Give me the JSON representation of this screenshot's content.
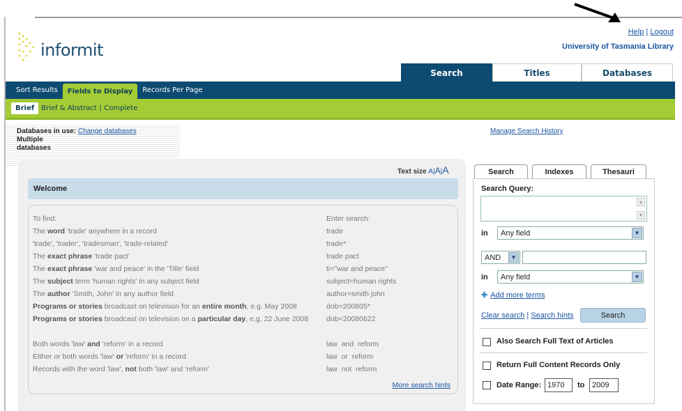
{
  "header": {
    "logo_text": "informit",
    "help": "Help",
    "sep": "|",
    "logout": "Logout",
    "library": "University of Tasmania Library"
  },
  "main_tabs": [
    {
      "label": "Search",
      "active": true
    },
    {
      "label": "Titles",
      "active": false
    },
    {
      "label": "Databases",
      "active": false
    }
  ],
  "nav": [
    {
      "label": "Sort Results",
      "active": false
    },
    {
      "label": "Fields to Display",
      "active": true
    },
    {
      "label": "Records Per Page",
      "active": false
    }
  ],
  "subnav": {
    "brief": "Brief",
    "brief_abstract": "Brief & Abstract",
    "sep": "|",
    "complete": "Complete"
  },
  "db_info": {
    "label": "Databases in use:",
    "change": "Change databases",
    "value_line1": "Multiple",
    "value_line2": "databases"
  },
  "manage_history": "Manage Search History",
  "text_size": {
    "label": "Text size",
    "a1": "A",
    "sep1": "|",
    "a2": "A",
    "sep2": "|",
    "a3": "A"
  },
  "welcome": "Welcome",
  "examples": {
    "head_find": "To find:",
    "head_enter": "Enter search:",
    "rows": [
      {
        "find": "The word 'trade' anywhere in a record",
        "enter": "trade"
      },
      {
        "find": "'trade', 'trader', 'tradesman', 'trade-related'",
        "enter": "trade*"
      },
      {
        "find": "The exact phrase 'trade pact'",
        "enter": "trade pact"
      },
      {
        "find": "The exact phrase 'war and peace' in the 'Title' field",
        "enter": "ti=\"war and peace\""
      },
      {
        "find": "The subject term 'human rights' in any subject field",
        "enter": "subject=human rights"
      },
      {
        "find": "The author 'Smith, John' in any author field",
        "enter": "author=smith john"
      },
      {
        "find": "Programs or stories broadcast on television for an entire month, e.g. May 2008",
        "enter": "dob=200805*"
      },
      {
        "find": "Programs or stories broadcast on television on a particular day, e.g. 22 June 2008",
        "enter": "dob=20080622"
      },
      {
        "find": "Both words 'law' and 'reform' in a record",
        "enter": "law  and  reform"
      },
      {
        "find": "Either or both words 'law' or 'reform' in a record",
        "enter": "law  or  reform"
      },
      {
        "find": "Records with the word 'law', not both 'law' and 'reform'",
        "enter": "law  not  reform"
      }
    ],
    "more_hints": "More search hints"
  },
  "search_panel": {
    "tabs": [
      "Search",
      "Indexes",
      "Thesauri"
    ],
    "query_label": "Search Query:",
    "query_value": "",
    "in_label": "in",
    "field1": "Any field",
    "operator": "AND",
    "term2": "",
    "field2": "Any field",
    "add_more": "Add more terms",
    "clear": "Clear search",
    "hints": "Search hints",
    "search_btn": "Search",
    "full_text": "Also Search Full Text of Articles",
    "full_content": "Return Full Content Records Only",
    "date_range": "Date Range:",
    "from": "1970",
    "to_label": "to",
    "to": "2009"
  }
}
